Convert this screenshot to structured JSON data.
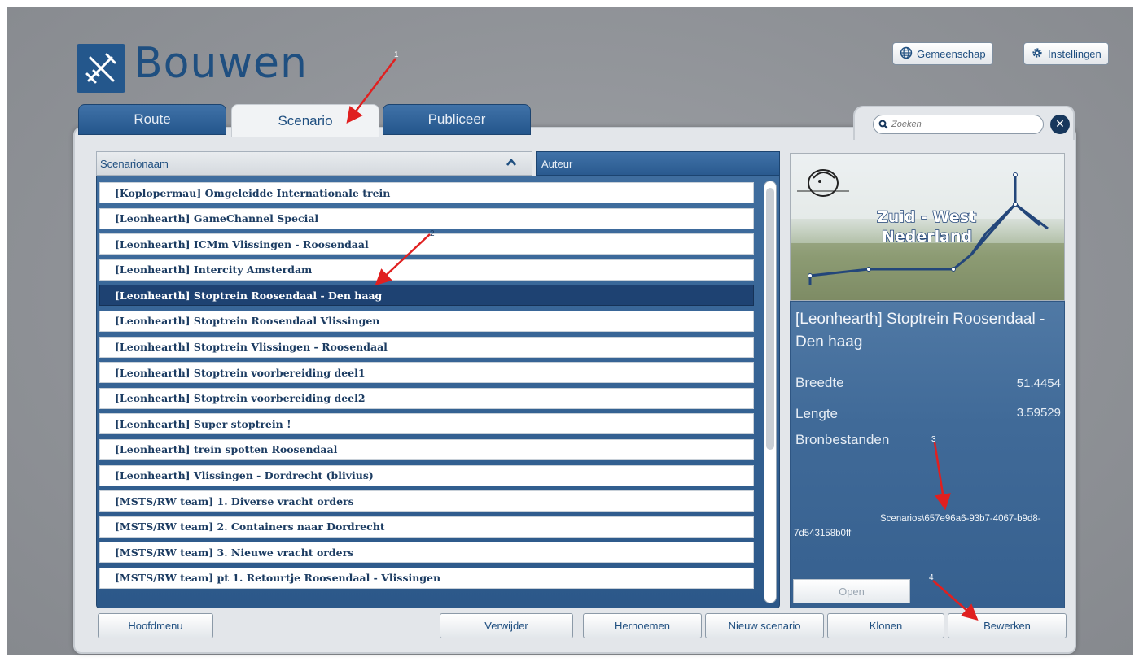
{
  "app": {
    "title": "Bouwen",
    "icon": "tools-icon"
  },
  "header": {
    "community_label": "Gemeenschap",
    "community_icon": "globe-icon",
    "settings_label": "Instellingen",
    "settings_icon": "gear-icon"
  },
  "tabs": [
    {
      "label": "Route",
      "active": false
    },
    {
      "label": "Scenario",
      "active": true
    },
    {
      "label": "Publiceer",
      "active": false
    }
  ],
  "search": {
    "placeholder": "Zoeken",
    "icon": "search-icon",
    "clear_icon": "close-icon"
  },
  "list": {
    "columns": [
      "Scenarionaam",
      "Auteur"
    ],
    "sort_icon": "chevron-up-icon",
    "selected_index": 4,
    "items": [
      "[Koplopermau] Omgeleidde Internationale trein",
      "[Leonhearth] GameChannel Special",
      "[Leonhearth] ICMm Vlissingen - Roosendaal",
      "[Leonhearth] Intercity Amsterdam",
      "[Leonhearth] Stoptrein Roosendaal - Den haag",
      "[Leonhearth] Stoptrein Roosendaal Vlissingen",
      "[Leonhearth] Stoptrein Vlissingen - Roosendaal",
      "[Leonhearth] Stoptrein voorbereiding deel1",
      "[Leonhearth] Stoptrein voorbereiding deel2",
      "[Leonhearth] Super stoptrein !",
      "[Leonhearth] trein spotten Roosendaal",
      "[Leonhearth] Vlissingen - Dordrecht (blivius)",
      "[MSTS/RW team] 1. Diverse vracht orders",
      "[MSTS/RW team] 2. Containers naar Dordrecht",
      "[MSTS/RW team] 3. Nieuwe vracht orders",
      "[MSTS/RW team] pt 1. Retourtje Roosendaal - Vlissingen"
    ]
  },
  "preview": {
    "line1": "Zuid - West",
    "line2": "Nederland"
  },
  "details": {
    "title": "[Leonhearth] Stoptrein Roosendaal - Den haag",
    "latitude_label": "Breedte",
    "latitude_value": "51.4454",
    "longitude_label": "Lengte",
    "longitude_value": "3.59529",
    "sources_label": "Bronbestanden",
    "source_path": "Scenarios\\657e96a6-93b7-4067-b9d8-7d543158b0ff",
    "open_label": "Open"
  },
  "buttons": {
    "main_menu": "Hoofdmenu",
    "delete": "Verwijder",
    "rename": "Hernoemen",
    "new_scenario": "Nieuw scenario",
    "clone": "Klonen",
    "edit": "Bewerken"
  },
  "annotations": [
    "1",
    "2",
    "3",
    "4"
  ],
  "colors": {
    "accent": "#24578c",
    "selected_row": "#1e4272",
    "arrow": "#e02020"
  }
}
